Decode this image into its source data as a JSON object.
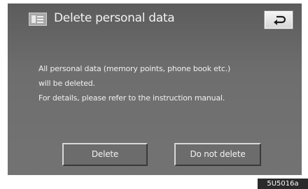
{
  "header": {
    "title": "Delete personal data",
    "title_icon": "document-list-icon",
    "back_icon": "return-arrow-icon"
  },
  "message": {
    "line1": "All personal data (memory points, phone book etc.)",
    "line2": "will be deleted.",
    "line3": "For details, please refer to the instruction manual."
  },
  "buttons": {
    "delete_label": "Delete",
    "do_not_delete_label": "Do not delete"
  },
  "figure_code": "5U5016a",
  "colors": {
    "screen_background": "#6e6e6e",
    "text": "#f0f0f0",
    "back_button": "#e6e6e6"
  }
}
